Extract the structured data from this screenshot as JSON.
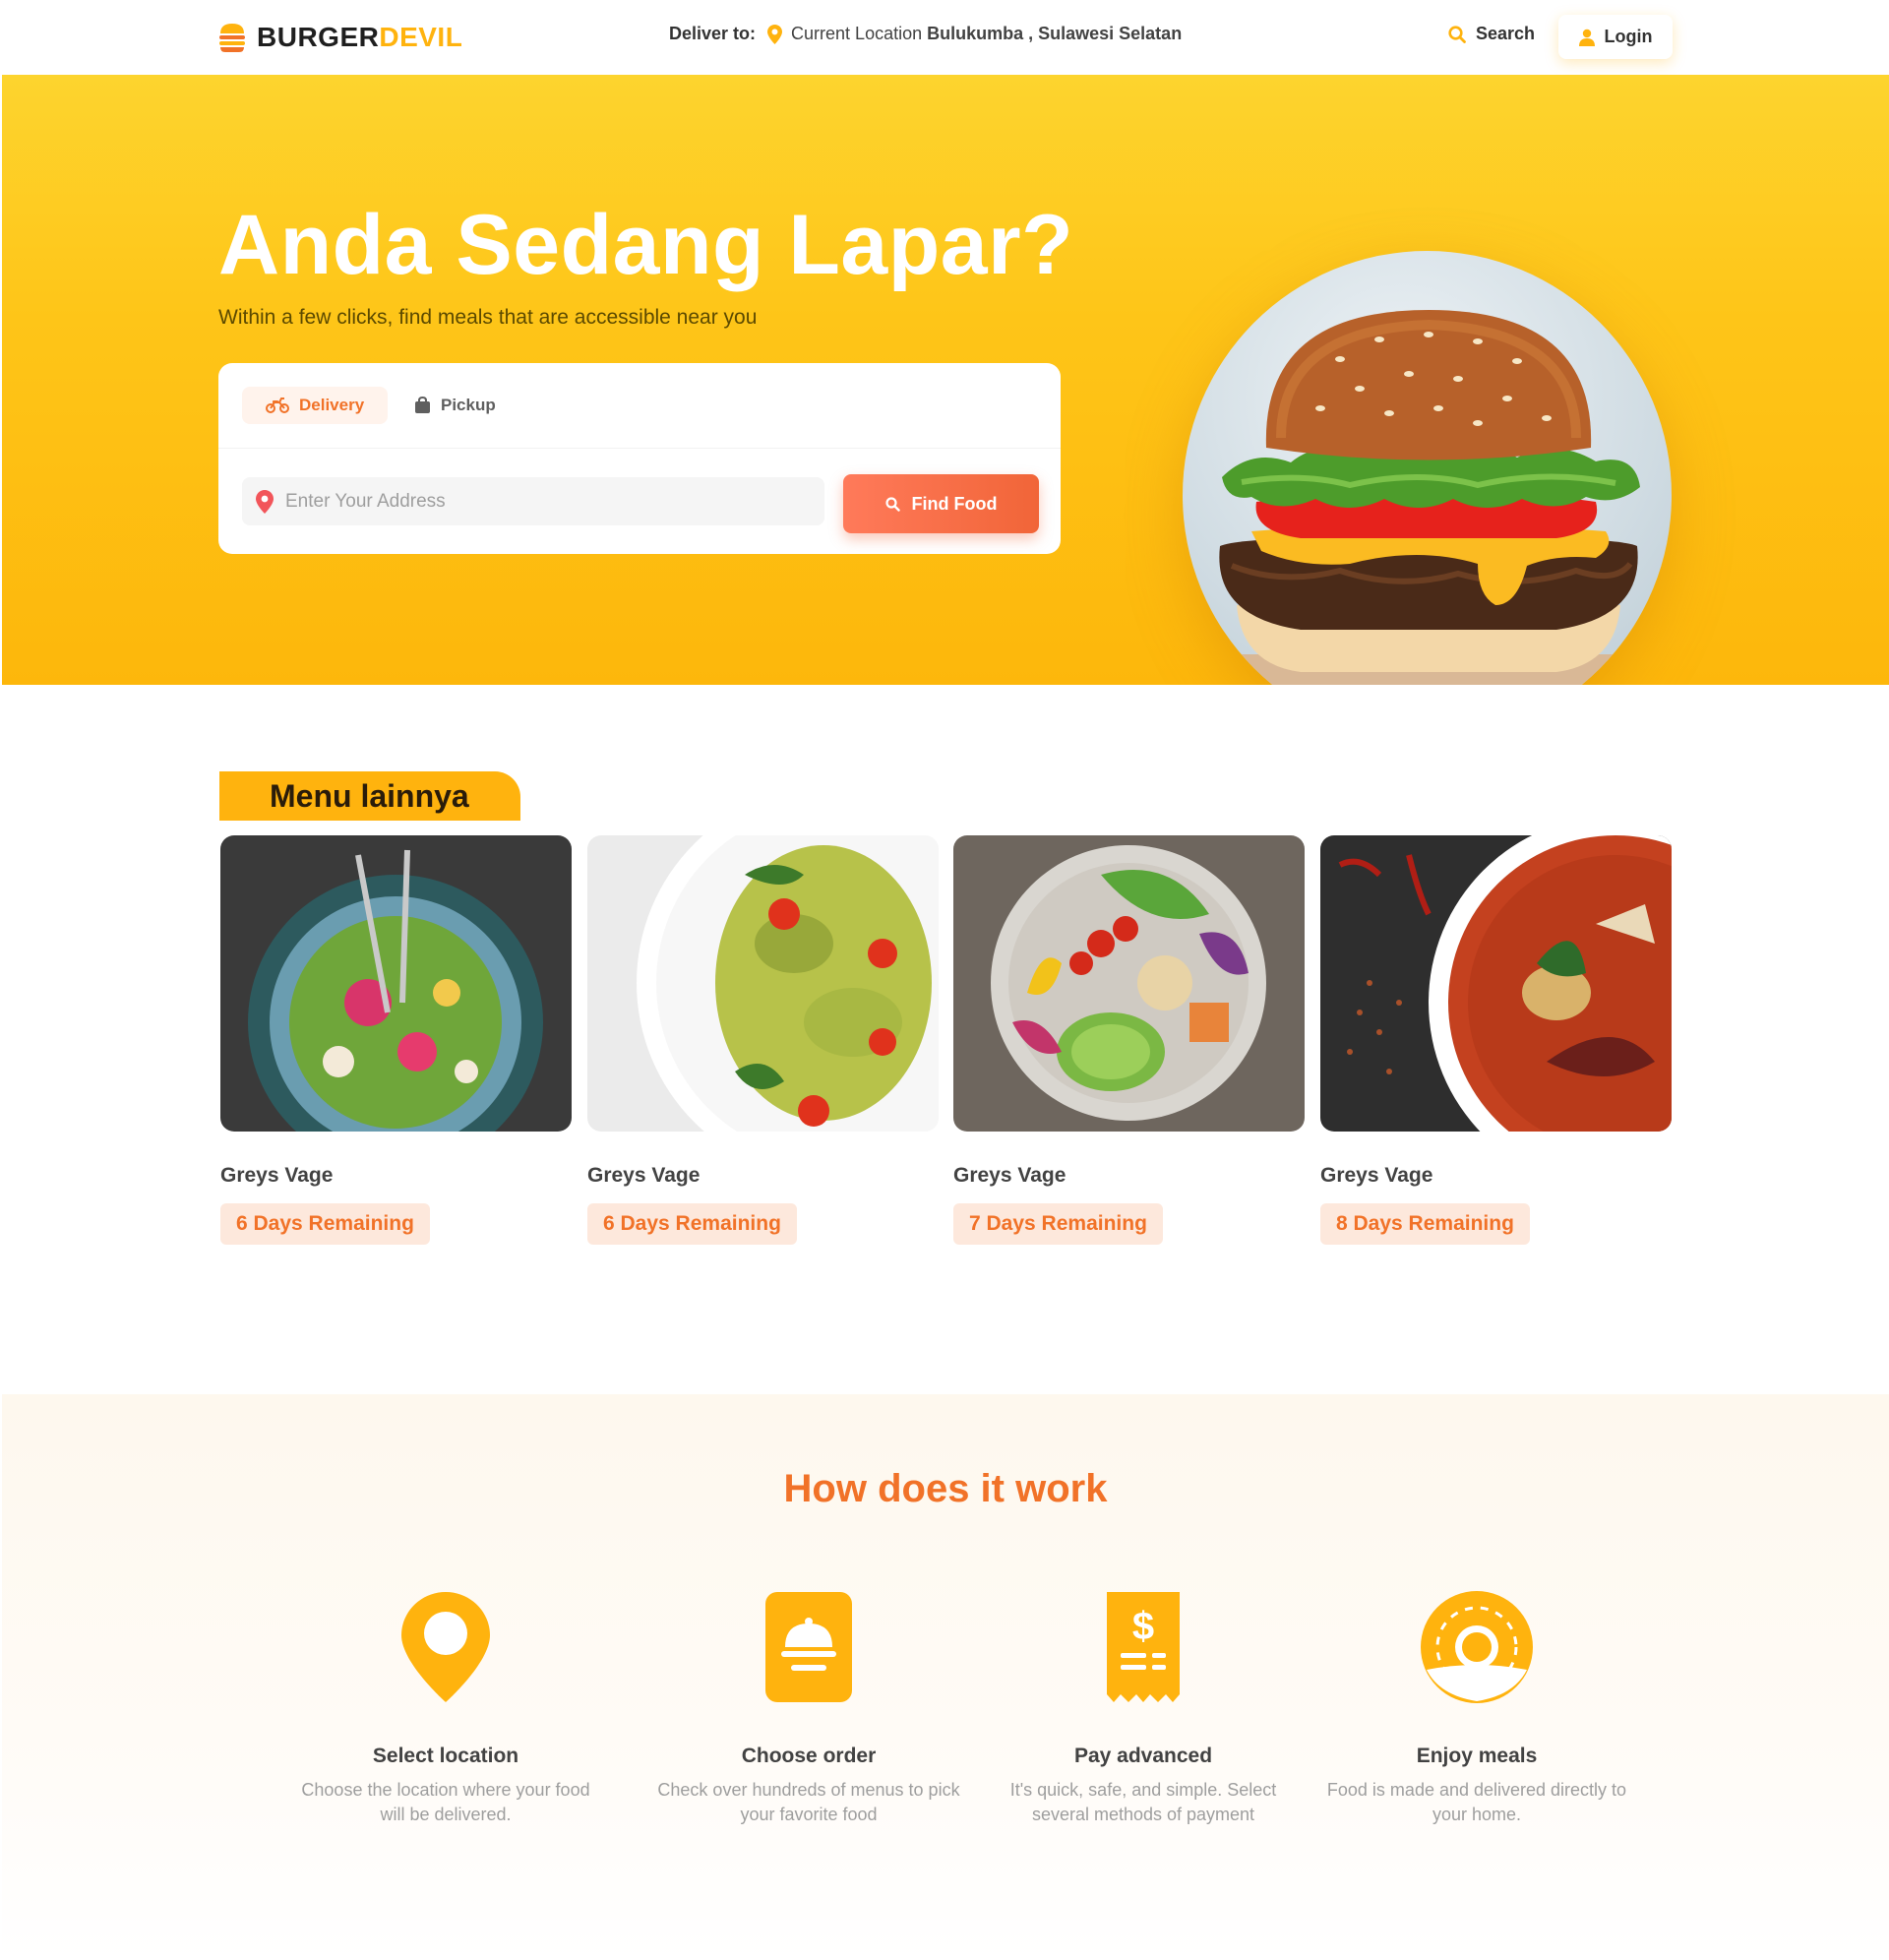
{
  "brand": {
    "name_part1": "BURGER",
    "name_part2": "DEVIL",
    "accent": "#ffb30e",
    "secondary": "#f17228"
  },
  "nav": {
    "deliver_label": "Deliver to:",
    "current_location_label": "Current Location",
    "location": "Bulukumba , Sulawesi Selatan",
    "search_label": "Search",
    "login_label": "Login"
  },
  "hero": {
    "title": "Anda Sedang Lapar?",
    "subtitle": "Within a few clicks, find meals that are accessible near you",
    "tabs": [
      {
        "label": "Delivery",
        "icon": "motorcycle-icon",
        "active": true
      },
      {
        "label": "Pickup",
        "icon": "bag-icon",
        "active": false
      }
    ],
    "address_placeholder": "Enter Your Address",
    "find_button": "Find Food"
  },
  "menu": {
    "heading": "Menu lainnya",
    "items": [
      {
        "title": "Greys Vage",
        "badge": "6 Days Remaining"
      },
      {
        "title": "Greys Vage",
        "badge": "6 Days Remaining"
      },
      {
        "title": "Greys Vage",
        "badge": "7 Days Remaining"
      },
      {
        "title": "Greys Vage",
        "badge": "8 Days Remaining"
      }
    ]
  },
  "how": {
    "title": "How does it work",
    "steps": [
      {
        "title": "Select location",
        "desc": "Choose the location where your food will be delivered.",
        "icon": "location-pin-icon"
      },
      {
        "title": "Choose order",
        "desc": "Check over hundreds of menus to pick your favorite food",
        "icon": "cloche-icon"
      },
      {
        "title": "Pay advanced",
        "desc": "It's quick, safe, and simple. Select several methods of payment",
        "icon": "receipt-icon"
      },
      {
        "title": "Enjoy meals",
        "desc": "Food is made and delivered directly to your home.",
        "icon": "donut-icon"
      }
    ]
  }
}
